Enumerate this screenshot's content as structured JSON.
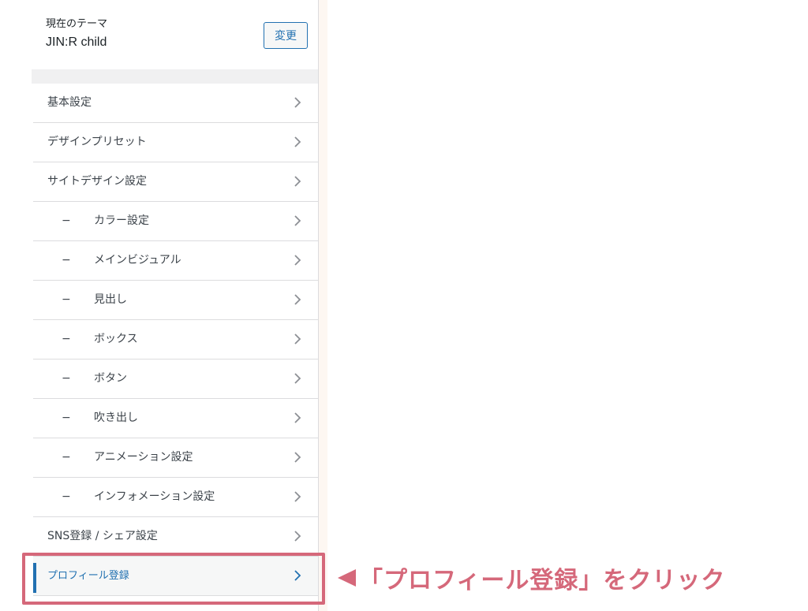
{
  "theme": {
    "caption": "現在のテーマ",
    "name": "JIN:R child",
    "change_label": "変更"
  },
  "menu": [
    {
      "label": "基本設定",
      "sub": false
    },
    {
      "label": "デザインプリセット",
      "sub": false
    },
    {
      "label": "サイトデザイン設定",
      "sub": false
    },
    {
      "label": "カラー設定",
      "sub": true
    },
    {
      "label": "メインビジュアル",
      "sub": true
    },
    {
      "label": "見出し",
      "sub": true
    },
    {
      "label": "ボックス",
      "sub": true
    },
    {
      "label": "ボタン",
      "sub": true
    },
    {
      "label": "吹き出し",
      "sub": true
    },
    {
      "label": "アニメーション設定",
      "sub": true
    },
    {
      "label": "インフォメーション設定",
      "sub": true
    },
    {
      "label": "SNS登録 / シェア設定",
      "sub": false
    },
    {
      "label": "プロフィール登録",
      "sub": false,
      "active": true
    }
  ],
  "sub_marker": "−",
  "annotation": {
    "text": "「プロフィール登録」をクリック",
    "color": "#d5687a"
  },
  "colors": {
    "accent": "#2271b1",
    "highlight": "#d5687a"
  },
  "icons": {
    "chevron": "chevron-right-icon",
    "pointer": "triangle-left-icon"
  }
}
